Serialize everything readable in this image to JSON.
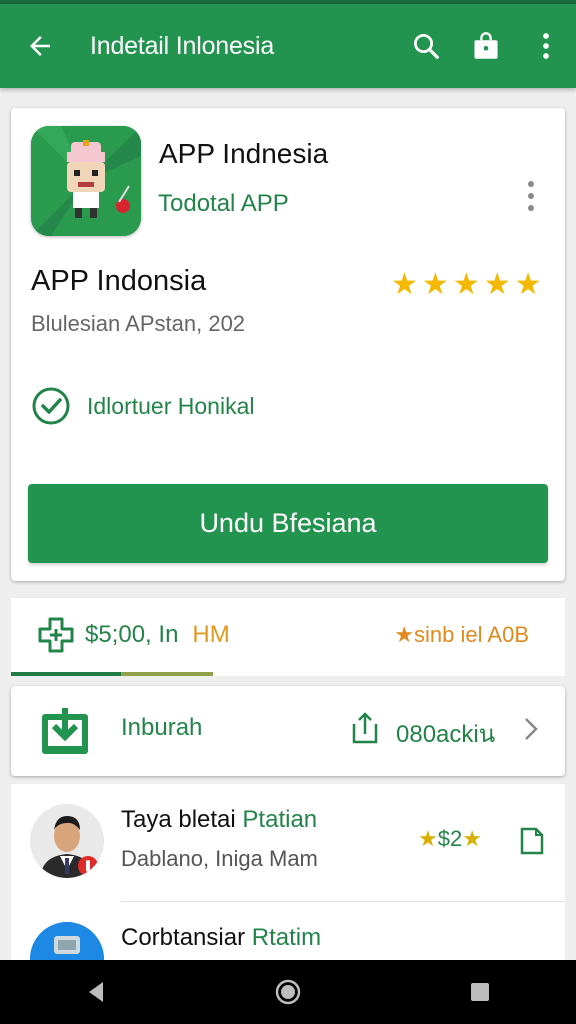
{
  "appbar": {
    "title": "Indetail Inlonesia",
    "icons": [
      "back-arrow-icon",
      "search-icon",
      "shopping-bag-icon",
      "more-vert-icon"
    ]
  },
  "app": {
    "name": "APP Indnesia",
    "developer": "Todotal APP",
    "title2": "APP Indonsia",
    "rating_stars": 5,
    "subtitle": "Blulesian APstan, 202",
    "verified_label": "Idlortuer Honikal",
    "install_label": "Undu Bfesiana"
  },
  "strip": {
    "price": "$5;00, In",
    "price_tag": "HM",
    "right_text": "★sinb iel A0B"
  },
  "downloads": {
    "label": "Inburah",
    "count": "080ackiน"
  },
  "list": [
    {
      "name_a": "Taya bletai",
      "name_b": "Ptatian",
      "sub": "Dablano, Iniga Mam",
      "rating": "$2"
    },
    {
      "name_a": "Corbtansiar",
      "name_b": "Rtatim",
      "sub": "",
      "rating": ""
    }
  ],
  "colors": {
    "primary": "#23944f",
    "primary_dark": "#1a6a3c",
    "star": "#f5b800",
    "accent_orange": "#e08a20"
  }
}
